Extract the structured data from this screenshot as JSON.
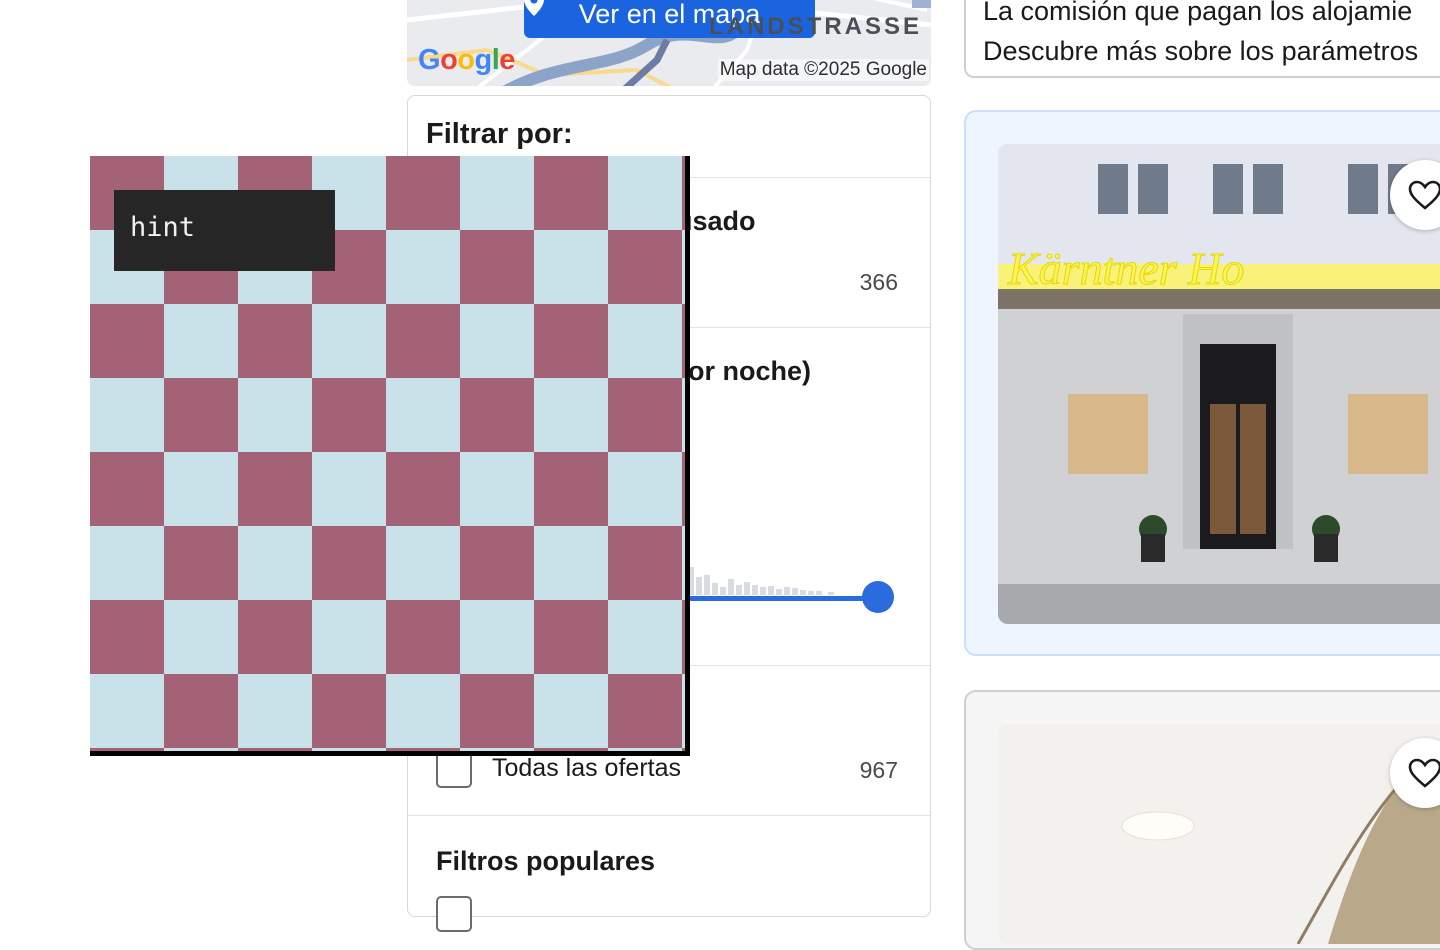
{
  "map": {
    "button_label": "Ver en el mapa",
    "pin_icon": "map-pin-icon",
    "street_label": "LANDSTRASSE",
    "google_logo": [
      "G",
      "o",
      "o",
      "g",
      "l",
      "e"
    ],
    "attribution": "Map data ©2025 Google"
  },
  "filters": {
    "title": "Filtrar por:",
    "sections": [
      {
        "heading_visible": "usado",
        "count": "366"
      },
      {
        "heading_visible": "or noche)"
      },
      {
        "checkbox_label": "Todas las ofertas",
        "count": "967"
      },
      {
        "heading": "Filtros populares"
      }
    ]
  },
  "right": {
    "info_lines": [
      "La comisión que pagan los alojamie",
      "Descubre más sobre los parámetros"
    ],
    "hotel_sign": "Kärntner Ho",
    "favorite_icon": "heart-icon"
  },
  "overlay": {
    "hint": "hint",
    "colors": {
      "dark": "#a36276",
      "light": "#c9e2e9"
    }
  }
}
